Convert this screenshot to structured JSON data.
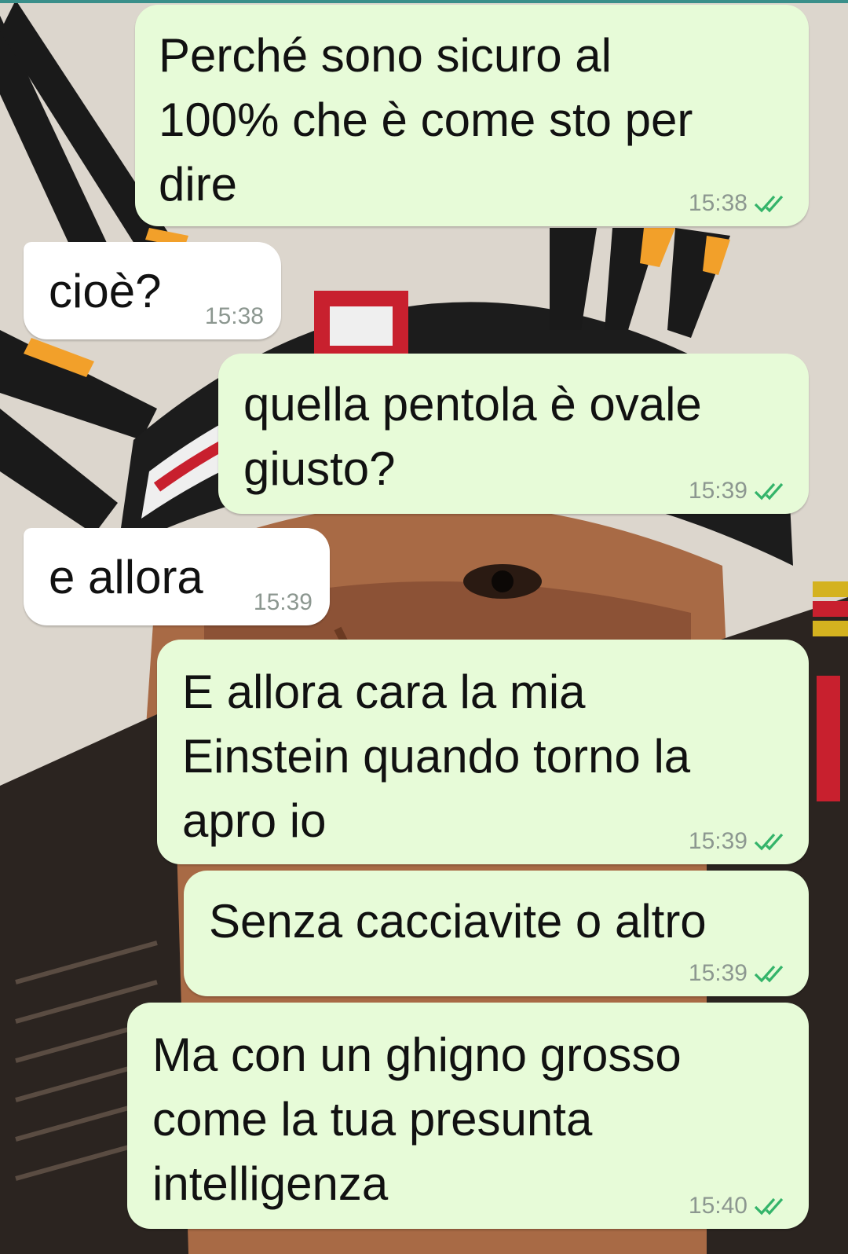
{
  "colors": {
    "outgoing_bubble": "#e7fbd8",
    "incoming_bubble": "#ffffff",
    "timestamp": "#8c9790",
    "read_ticks": "#34b46a"
  },
  "messages": [
    {
      "direction": "outgoing",
      "text": "Perché sono sicuro al\n100% che è come sto per\ndire",
      "time": "15:38",
      "status": "read-double-check-icon"
    },
    {
      "direction": "incoming",
      "text": "cioè?",
      "time": "15:38"
    },
    {
      "direction": "outgoing",
      "text": "quella pentola è ovale\ngiusto?",
      "time": "15:39",
      "status": "read-double-check-icon"
    },
    {
      "direction": "incoming",
      "text": "e allora",
      "time": "15:39"
    },
    {
      "direction": "outgoing",
      "text": "E allora cara la mia\nEinstein quando torno la\napro io",
      "time": "15:39",
      "status": "read-double-check-icon"
    },
    {
      "direction": "outgoing",
      "text": "Senza cacciavite o altro",
      "time": "15:39",
      "status": "read-double-check-icon"
    },
    {
      "direction": "outgoing",
      "text": "Ma con un ghigno grosso\ncome la tua presunta\nintelligenza",
      "time": "15:40",
      "status": "read-double-check-icon"
    }
  ]
}
